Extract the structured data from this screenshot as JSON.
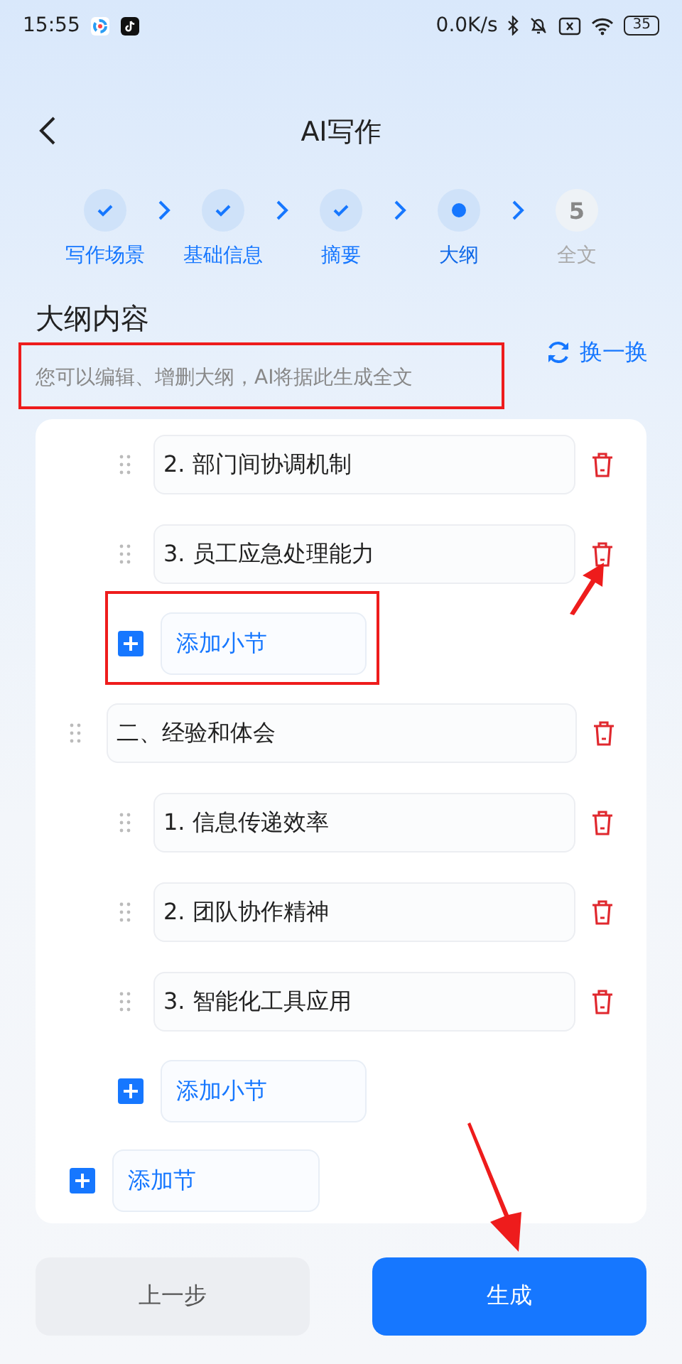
{
  "status_bar": {
    "time": "15:55",
    "network_speed": "0.0K/s",
    "battery": "35"
  },
  "header": {
    "title": "AI写作"
  },
  "steps": [
    {
      "label": "写作场景",
      "completed": true,
      "current": false
    },
    {
      "label": "基础信息",
      "completed": true,
      "current": false
    },
    {
      "label": "摘要",
      "completed": true,
      "current": false
    },
    {
      "label": "大纲",
      "completed": false,
      "current": true
    },
    {
      "label": "全文",
      "completed": false,
      "current": false,
      "number": "5"
    }
  ],
  "outline_header": {
    "title": "大纲内容",
    "hint": "您可以编辑、增删大纲，AI将据此生成全文",
    "refresh_label": "换一换"
  },
  "outline": [
    {
      "children": [
        "2. 部门间协调机制",
        "3. 员工应急处理能力"
      ],
      "add_label": "添加小节"
    },
    {
      "title": "二、经验和体会",
      "children": [
        "1. 信息传递效率",
        "2. 团队协作精神",
        "3. 智能化工具应用"
      ],
      "add_label": "添加小节"
    }
  ],
  "add_section_label": "添加节",
  "buttons": {
    "previous": "上一步",
    "generate": "生成"
  }
}
